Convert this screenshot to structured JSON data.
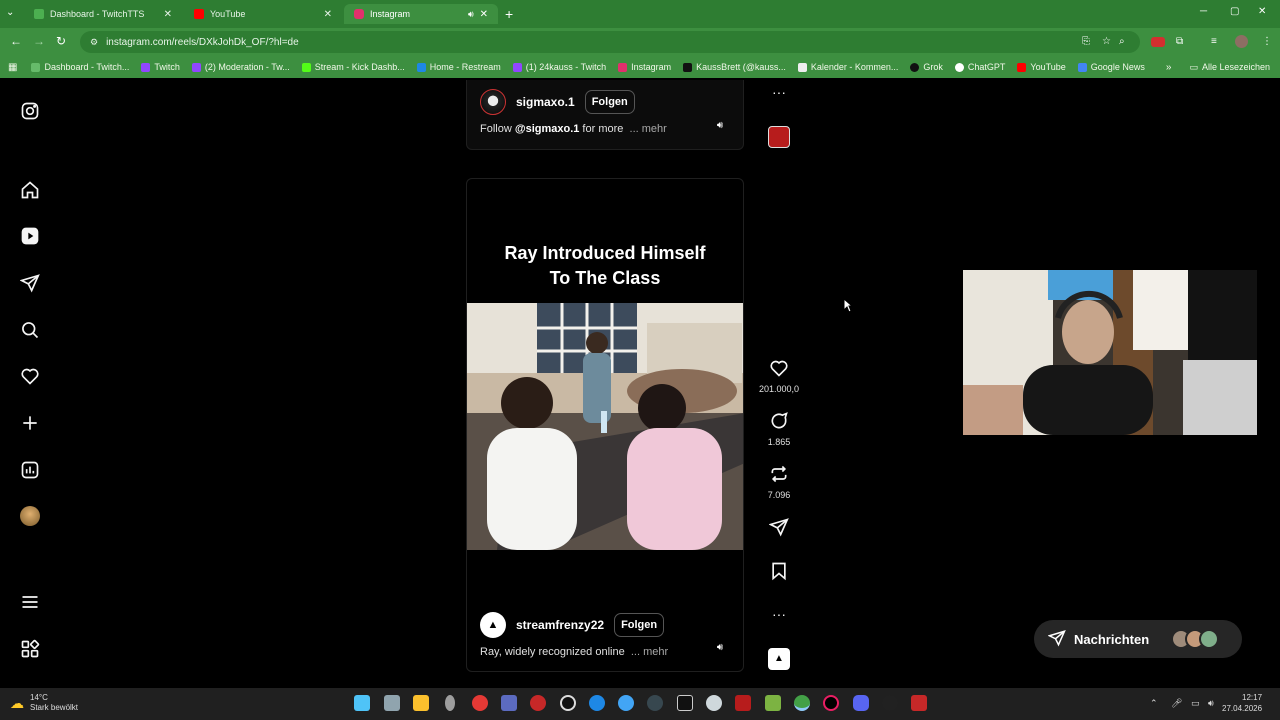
{
  "browser": {
    "tabs": [
      {
        "label": "Dashboard - TwitchTTS",
        "favicon_color": "#4caf50"
      },
      {
        "label": "YouTube",
        "favicon_color": "#ff0000"
      },
      {
        "label": "Instagram",
        "favicon_color": "#e1306c"
      }
    ],
    "url": "instagram.com/reels/DXkJohDk_OF/?hl=de",
    "bookmarks": [
      "Dashboard - Twitch...",
      "Twitch",
      "(2) Moderation - Tw...",
      "Stream - Kick Dashb...",
      "Home - Restream",
      "(1) 24kauss - Twitch",
      "Instagram",
      "KaussBrett (@kauss...",
      "Kalender - Kommen...",
      "Grok",
      "ChatGPT",
      "YouTube",
      "Google News"
    ],
    "all_bookmarks": "Alle Lesezeichen"
  },
  "sidebar": {
    "icons": [
      "instagram-logo-icon",
      "home-icon",
      "reels-icon",
      "messages-icon",
      "search-icon",
      "notifications-icon",
      "create-icon",
      "dashboard-icon",
      "profile-avatar",
      "menu-icon",
      "more-apps-icon"
    ]
  },
  "reel1": {
    "username": "sigmaxo.1",
    "follow_label": "Folgen",
    "caption_prefix": "Follow ",
    "caption_mention": "@sigmaxo.1",
    "caption_rest": " for more",
    "caption_more": "... mehr"
  },
  "reel2": {
    "title_line1": "Ray Introduced Himself",
    "title_line2": "To The Class",
    "username": "streamfrenzy22",
    "follow_label": "Folgen",
    "caption": "Ray, widely recognized online",
    "caption_more": "... mehr"
  },
  "actions": {
    "likes": "201.000,0",
    "comments": "1.865",
    "reposts": "7.096"
  },
  "messages_pill": {
    "label": "Nachrichten"
  },
  "taskbar": {
    "temperature": "14°C",
    "weather": "Stark bewölkt",
    "time": "12:17",
    "date": "27.04.2026"
  },
  "colors": {
    "chrome_green": "#2e7d32",
    "ig_background": "#000000",
    "pill": "#262626"
  }
}
